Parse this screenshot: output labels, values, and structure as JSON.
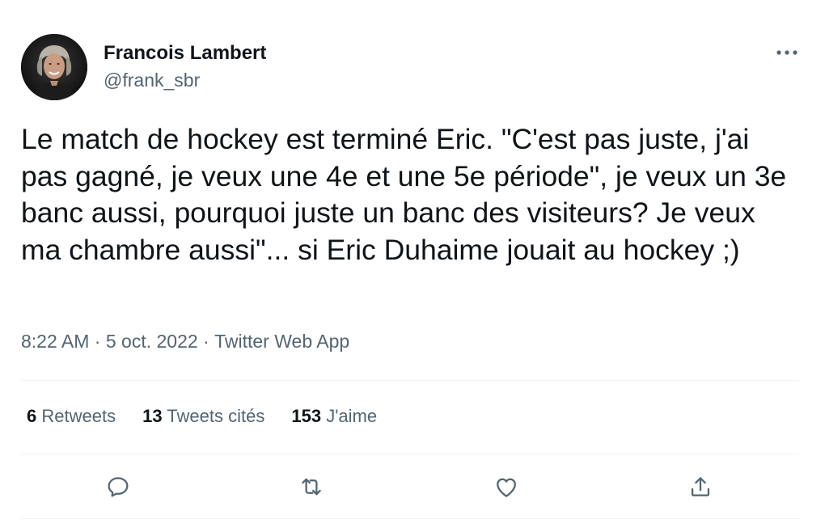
{
  "author": {
    "display_name": "Francois Lambert",
    "handle": "@frank_sbr",
    "avatar_icon": "profile-photo"
  },
  "tweet": {
    "text": "Le match de hockey est terminé Eric. \"C'est pas juste, j'ai pas gagné, je veux une 4e et une 5e période\", je veux un 3e banc aussi, pourquoi juste un banc des visiteurs? Je veux ma chambre aussi\"... si Eric Duhaime jouait au hockey ;)",
    "time": "8:22 AM",
    "separator": "·",
    "date": "5 oct. 2022",
    "source": "Twitter Web App"
  },
  "stats": {
    "retweets_count": "6",
    "retweets_label": "Retweets",
    "quotes_count": "13",
    "quotes_label": "Tweets cités",
    "likes_count": "153",
    "likes_label": "J'aime"
  },
  "actions": {
    "icons": [
      "reply-icon",
      "retweet-icon",
      "like-icon",
      "share-icon"
    ]
  },
  "colors": {
    "text_primary": "#0f1419",
    "text_secondary": "#536471",
    "divider": "#eff3f4",
    "icon": "#536471"
  }
}
